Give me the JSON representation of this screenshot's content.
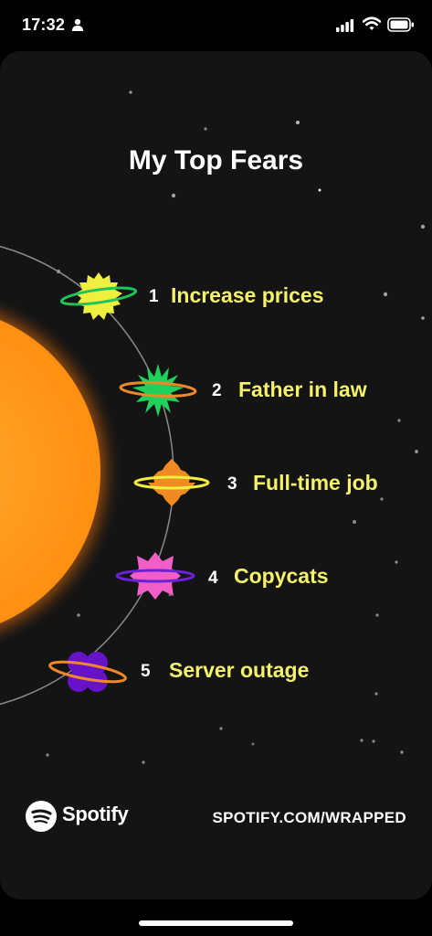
{
  "status_bar": {
    "time": "17:32",
    "icons": [
      "person-icon",
      "signal-icon",
      "wifi-icon",
      "battery-icon"
    ]
  },
  "card": {
    "title": "My Top Fears",
    "fears": [
      {
        "rank": "1",
        "label": "Increase prices",
        "planet": "yellow-spiky-planet"
      },
      {
        "rank": "2",
        "label": "Father in law",
        "planet": "green-burst-planet"
      },
      {
        "rank": "3",
        "label": "Full-time job",
        "planet": "orange-diamond-planet"
      },
      {
        "rank": "4",
        "label": "Copycats",
        "planet": "pink-star-planet"
      },
      {
        "rank": "5",
        "label": "Server outage",
        "planet": "purple-clover-planet"
      }
    ],
    "footer": {
      "brand": "Spotify",
      "url": "SPOTIFY.COM/WRAPPED"
    }
  },
  "colors": {
    "background": "#141414",
    "fear_text": "#f5f16a",
    "sun": "#ff9a1f",
    "orbit": "#8a8a8a"
  }
}
